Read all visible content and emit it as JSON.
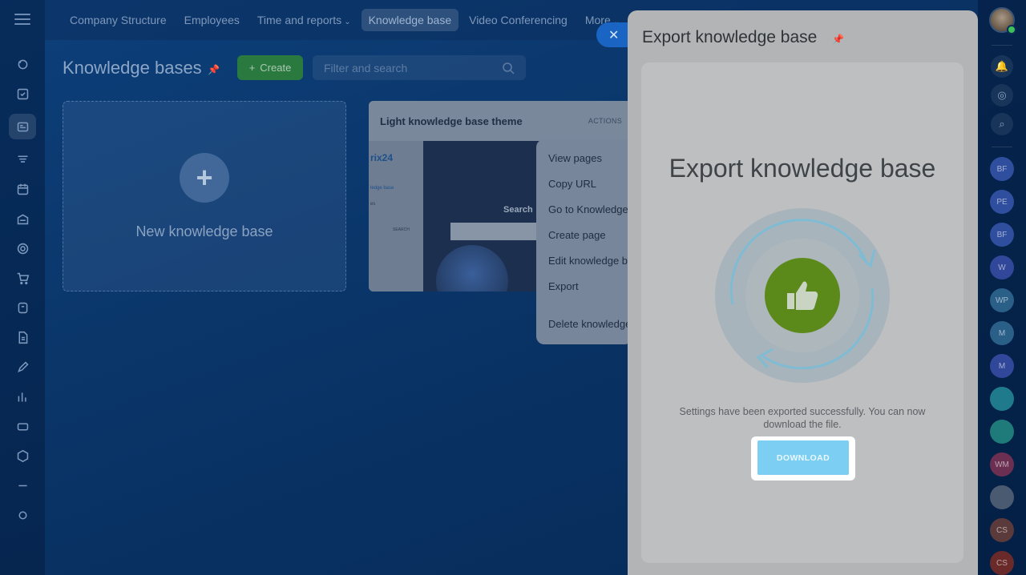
{
  "nav": {
    "items": [
      {
        "label": "Company Structure"
      },
      {
        "label": "Employees"
      },
      {
        "label": "Time and reports"
      },
      {
        "label": "Knowledge base"
      },
      {
        "label": "Video Conferencing"
      },
      {
        "label": "More"
      }
    ]
  },
  "page": {
    "title": "Knowledge bases",
    "create_label": "Create",
    "search_placeholder": "Filter and search"
  },
  "new_card": {
    "label": "New knowledge base",
    "plus": "+"
  },
  "kb_card": {
    "title": "Light knowledge base theme",
    "actions": "ACTIONS",
    "thumb_logo": "rix24",
    "thumb_link": "ledge base",
    "thumb_line": "es",
    "thumb_search_btn": "SEARCH",
    "thumb_hero_text": "Search"
  },
  "context_menu": {
    "items": [
      "View pages",
      "Copy URL",
      "Go to Knowledge",
      "Create page",
      "Edit knowledge b",
      "Export"
    ],
    "danger": "Delete knowledge"
  },
  "close_label": "✕",
  "slider": {
    "title": "Export knowledge base",
    "heading": "Export knowledge base",
    "message": "Settings have been exported successfully. You can now download the file.",
    "download_label": "DOWNLOAD"
  },
  "right_bar": {
    "avatars": [
      {
        "initials": "BF",
        "color": "#2f4f9e"
      },
      {
        "initials": "PE",
        "color": "#2f4f9e"
      },
      {
        "initials": "BF",
        "color": "#2f4f9e"
      },
      {
        "initials": "W",
        "color": "#31479a"
      },
      {
        "initials": "WP",
        "color": "#2a5f88"
      },
      {
        "initials": "M",
        "color": "#2a5f88"
      },
      {
        "initials": "M",
        "color": "#31479a"
      },
      {
        "initials": "",
        "color": "#1f7a8c"
      },
      {
        "initials": "",
        "color": "#1f7a7a"
      },
      {
        "initials": "WM",
        "color": "#6b2f52"
      },
      {
        "initials": "",
        "color": "#4a5a70"
      },
      {
        "initials": "CS",
        "color": "#5a3a3a"
      },
      {
        "initials": "CS",
        "color": "#6a2a2a"
      }
    ]
  }
}
